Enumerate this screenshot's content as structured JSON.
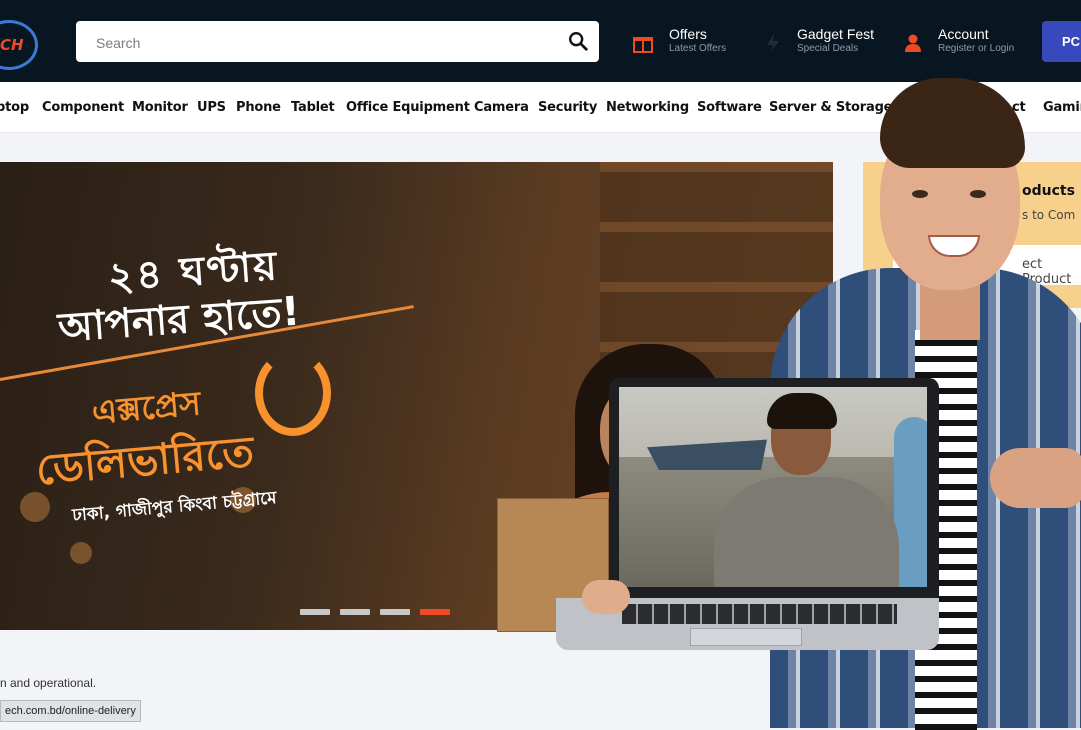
{
  "header": {
    "logo_text": "CH",
    "search": {
      "placeholder": "Search"
    },
    "offers": {
      "title": "Offers",
      "subtitle": "Latest Offers"
    },
    "gadget_fest": {
      "title": "Gadget Fest",
      "subtitle": "Special Deals"
    },
    "account": {
      "title": "Account",
      "subtitle": "Register or Login"
    },
    "pc_button": "PC"
  },
  "nav": {
    "items": [
      "ptop",
      "Component",
      "Monitor",
      "UPS",
      "Phone",
      "Tablet",
      "Office Equipment",
      "Camera",
      "Security",
      "Networking",
      "Software",
      "Server & Storage",
      "ct",
      "Gamin"
    ]
  },
  "banner": {
    "line1": "২৪ ঘণ্টায়",
    "line2": "আপনার হাতে!",
    "line3": "এক্সপ্রেস",
    "line4": "ডেলিভারিতে",
    "line5": "ঢাকা, গাজীপুর কিংবা চট্টগ্রামে",
    "slides": 4,
    "active_slide": 4
  },
  "promo": {
    "title": "oducts",
    "subtitle": "s to Com",
    "button": "ect Product"
  },
  "status_text": "n and operational.",
  "status_url": "ech.com.bd/online-delivery",
  "colors": {
    "header_bg": "#081621",
    "accent": "#ef4a23",
    "primary": "#3749bb"
  }
}
